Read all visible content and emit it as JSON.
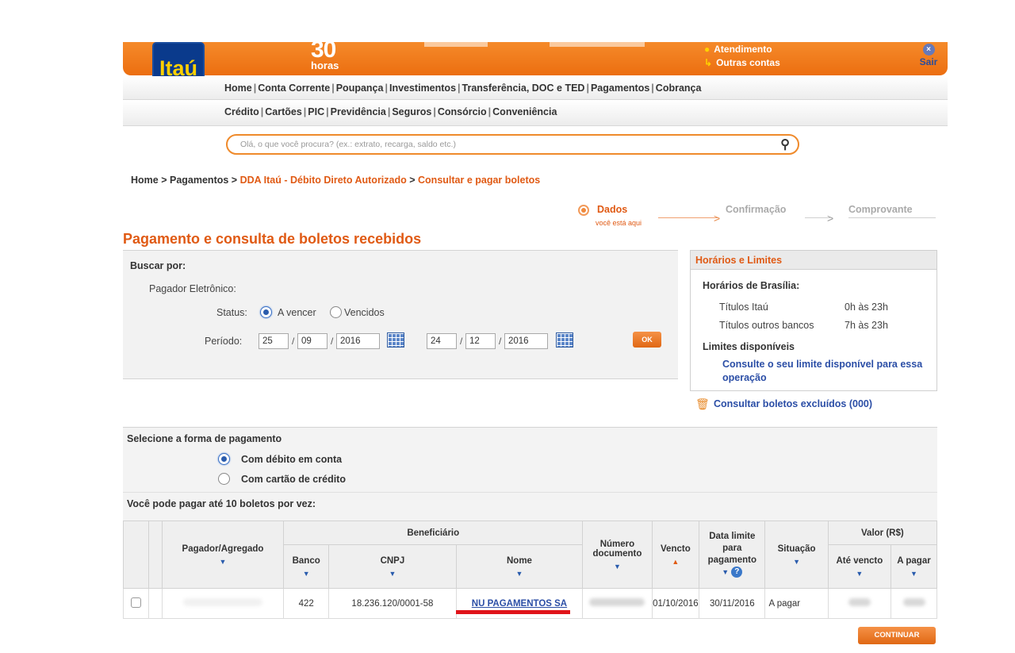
{
  "banner": {
    "logo": "Itaú",
    "hours_number": "30",
    "hours_label": "horas",
    "link_atendimento": "Atendimento",
    "link_outras_contas": "Outras contas",
    "sair": "Sair"
  },
  "menu1": [
    "Home",
    "Conta Corrente",
    "Poupança",
    "Investimentos",
    "Transferência, DOC e TED",
    "Pagamentos",
    "Cobrança"
  ],
  "menu2": [
    "Crédito",
    "Cartões",
    "PIC",
    "Previdência",
    "Seguros",
    "Consórcio",
    "Conveniência"
  ],
  "search": {
    "placeholder": "Olá, o que você procura? (ex.: extrato, recarga, saldo etc.)"
  },
  "breadcrumb": {
    "home": "Home",
    "pagamentos": "Pagamentos",
    "dda": "DDA Itaú - Débito Direto Autorizado",
    "current": "Consultar e pagar boletos"
  },
  "steps": {
    "step1": "Dados",
    "step1_sub": "você está aqui",
    "step2": "Confirmação",
    "step3": "Comprovante"
  },
  "page_title": "Pagamento e consulta de boletos recebidos",
  "filters": {
    "buscar_por": "Buscar por:",
    "pagador": "Pagador Eletrônico:",
    "status_label": "Status:",
    "status_a_vencer": "A vencer",
    "status_vencidos": "Vencidos",
    "periodo_label": "Período:",
    "from_day": "25",
    "from_month": "09",
    "from_year": "2016",
    "to_day": "24",
    "to_month": "12",
    "to_year": "2016",
    "ok": "OK"
  },
  "sidebox": {
    "title": "Horários e Limites",
    "horarios": "Horários de Brasília:",
    "titulos_itau": "Títulos Itaú",
    "titulos_itau_time": "0h às 23h",
    "titulos_outros": "Títulos outros bancos",
    "titulos_outros_time": "7h às 23h",
    "limites": "Limites disponíveis",
    "limite_link": "Consulte o seu limite disponível para essa operação"
  },
  "excluidos_link": "Consultar boletos excluídos (000)",
  "payment": {
    "title": "Selecione a forma de pagamento",
    "opt_debito": "Com débito em conta",
    "opt_cartao": "Com cartão de crédito",
    "note": "Você pode pagar até 10 boletos por vez:"
  },
  "table": {
    "h_pagador": "Pagador/Agregado",
    "h_beneficiario": "Beneficiário",
    "h_banco": "Banco",
    "h_cnpj": "CNPJ",
    "h_nome": "Nome",
    "h_numero1": "Número",
    "h_numero2": "documento",
    "h_vencto": "Vencto",
    "h_data1": "Data limite",
    "h_data2": "para",
    "h_data3": "pagamento",
    "h_situacao": "Situação",
    "h_valor": "Valor (R$)",
    "h_ate_vencto": "Até vencto",
    "h_a_pagar": "A pagar",
    "row": {
      "banco": "422",
      "cnpj": "18.236.120/0001-58",
      "nome": "NU PAGAMENTOS SA",
      "vencto": "01/10/2016",
      "data_limite": "30/11/2016",
      "situacao": "A pagar"
    }
  },
  "continue_button": "CONTINUAR",
  "colors": {
    "brand_orange": "#ec6e10",
    "brand_blue": "#0a3a8c",
    "link_blue": "#2b4ea6",
    "accent_red": "#e0141a"
  }
}
